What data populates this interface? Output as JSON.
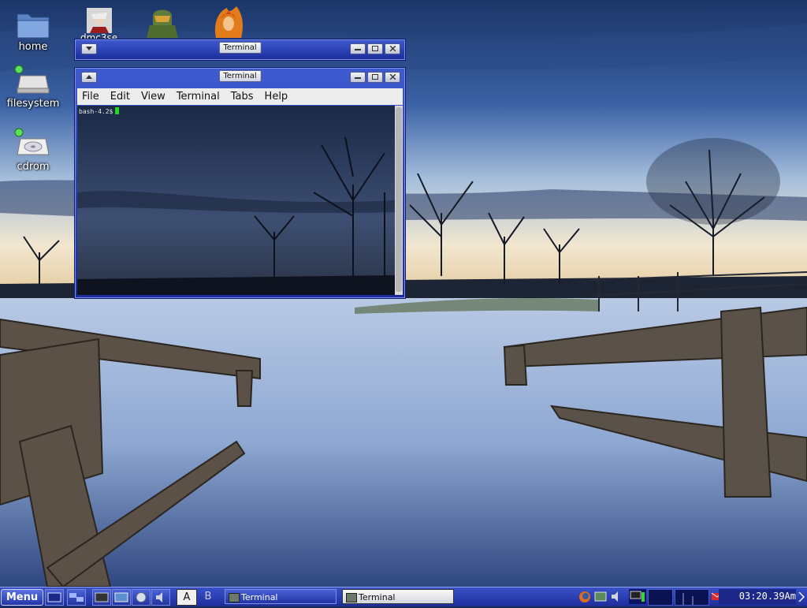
{
  "desktop": {
    "icons": [
      {
        "label": "home"
      },
      {
        "label": "filesystem"
      },
      {
        "label": "cdrom"
      }
    ],
    "app_shortcuts": [
      {
        "label": "dmc3se"
      },
      {
        "label": ""
      },
      {
        "label": ""
      }
    ]
  },
  "windows": [
    {
      "title": "Terminal",
      "state": "shaded"
    },
    {
      "title": "Terminal",
      "state": "focused",
      "menu": [
        "File",
        "Edit",
        "View",
        "Terminal",
        "Tabs",
        "Help"
      ],
      "prompt": "bash-4.2$"
    }
  ],
  "taskbar": {
    "menu_label": "Menu",
    "workspaces": [
      "A",
      "B"
    ],
    "tasks": [
      {
        "label": "Terminal",
        "focused": false
      },
      {
        "label": "Terminal",
        "focused": true
      }
    ],
    "clock": "03:20.39Am",
    "colors": {
      "panel": "#2236b0",
      "accent": "#3f5bd0"
    }
  }
}
